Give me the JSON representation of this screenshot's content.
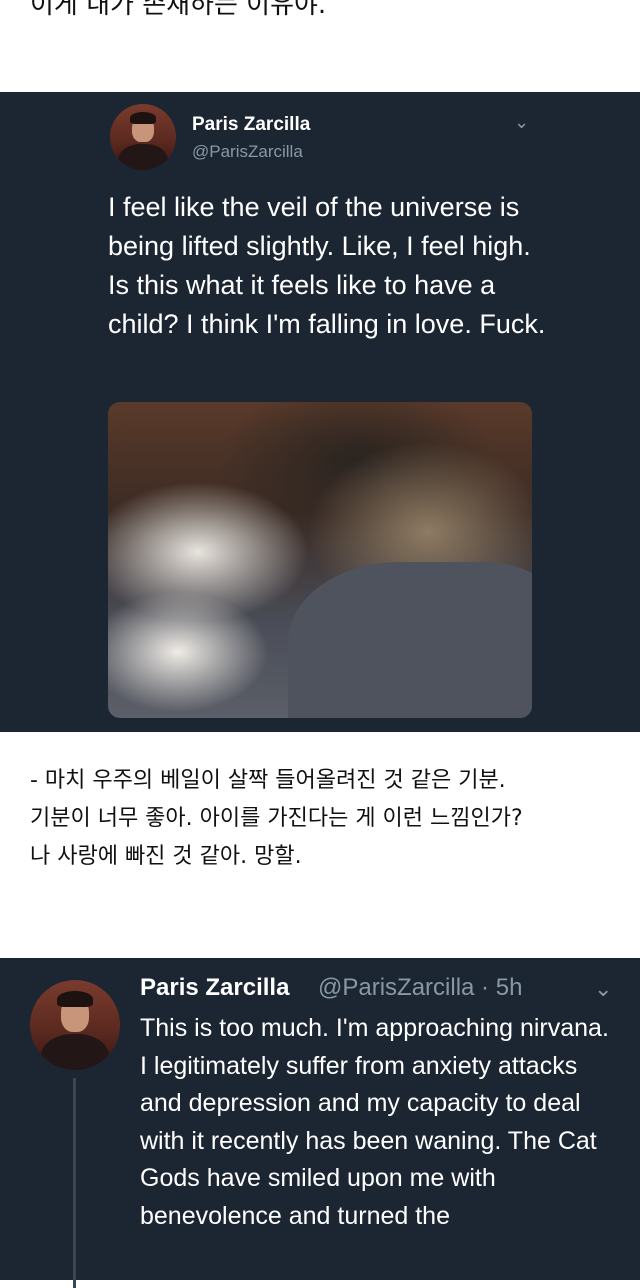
{
  "top_caption": "이게 내가 존재하는 이유야.",
  "tweet1": {
    "name": "Paris Zarcilla",
    "handle": "@ParisZarcilla",
    "text": "I feel like the veil of the universe is being lifted slightly. Like, I feel high. Is this what it feels like to have a child? I think I'm falling in love. Fuck.",
    "menu_icon": "chevron-down-icon"
  },
  "translation": {
    "line1": "- 마치 우주의 베일이 살짝 들어올려진 것 같은 기분.",
    "line2": "기분이 너무 좋아. 아이를 가진다는 게 이런 느낌인가?",
    "line3": "나 사랑에 빠진 것 같아. 망할."
  },
  "tweet2": {
    "name": "Paris Zarcilla",
    "handle_time": "@ParisZarcilla · 5h",
    "text": "This is too much. I'm approaching nirvana. I legitimately suffer from anxiety attacks and depression and my capacity to deal with it recently has been waning. The Cat Gods have smiled upon me with benevolence and turned the"
  },
  "colors": {
    "tweet_background": "#1c2532",
    "secondary_text": "#8899a6",
    "page_background": "#ffffff"
  }
}
